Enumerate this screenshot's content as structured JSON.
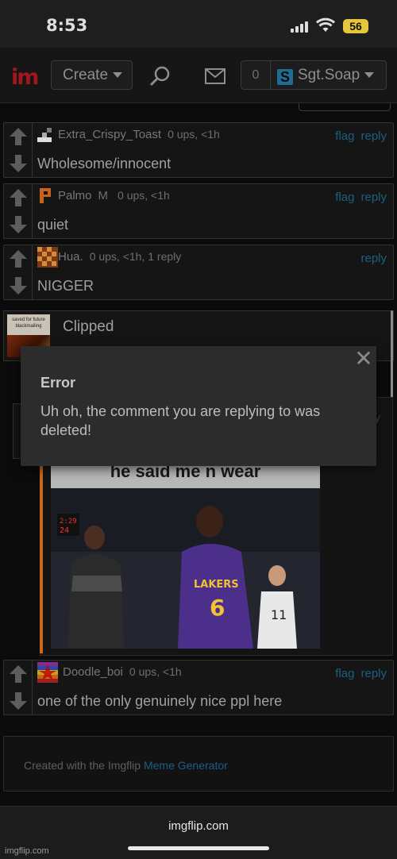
{
  "status_bar": {
    "time": "8:53",
    "battery": "56"
  },
  "nav": {
    "logo": "im",
    "create_label": "Create",
    "notifications_count": "0",
    "user_badge": "S",
    "username": "Sgt.Soap"
  },
  "comments": [
    {
      "username": "Extra_Crispy_Toast",
      "meta": "0 ups, <1h",
      "flag": "flag",
      "reply": "reply",
      "text": "Wholesome/innocent"
    },
    {
      "username": "Palmo",
      "mod": "M",
      "meta": "0 ups, <1h",
      "flag": "flag",
      "reply": "reply",
      "text": "quiet"
    },
    {
      "username": "Hua.",
      "meta": "0 ups, <1h, 1 reply",
      "reply": "reply",
      "text": "NIGGER"
    }
  ],
  "clipped": {
    "label": "Clipped",
    "thumb_caption": "saved for future blackmailing"
  },
  "meme": {
    "caption": "he said me n wear",
    "jersey_text": "LAKERS",
    "jersey_number": "6",
    "clock": "2:29",
    "clock2": "24"
  },
  "background_ghost": {
    "t": "t",
    "reply": "ply"
  },
  "error_dialog": {
    "close": "✕",
    "title": "Error",
    "message": "Uh oh, the comment you are replying to was deleted!"
  },
  "comment_bottom": {
    "username": "Doodle_boi",
    "meta": "0 ups, <1h",
    "flag": "flag",
    "reply": "reply",
    "text": "one of the only genuinely nice ppl here"
  },
  "footer": {
    "prefix": "Created with the Imgflip ",
    "link": "Meme Generator"
  },
  "browser": {
    "url": "imgflip.com"
  },
  "watermark": "imgflip.com"
}
